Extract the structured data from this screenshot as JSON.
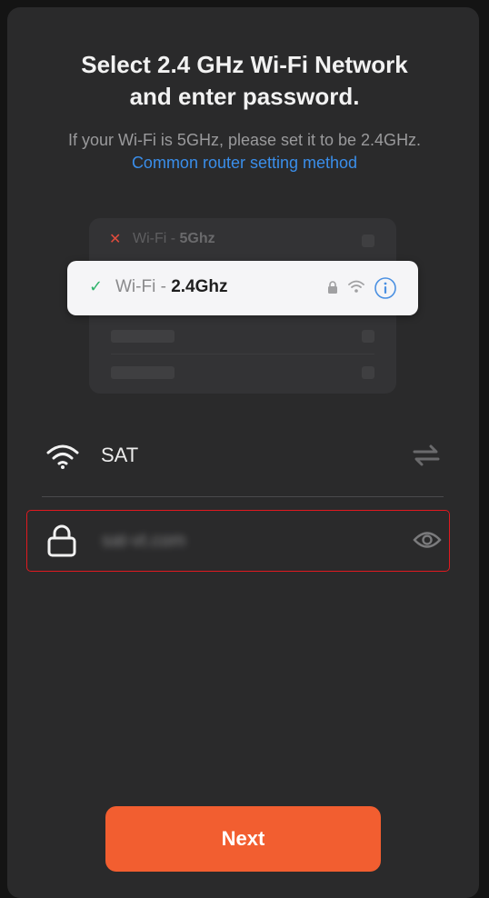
{
  "header": {
    "title": "Select 2.4 GHz Wi-Fi Network\nand enter password.",
    "subtitle_text": "If your Wi-Fi is 5GHz, please set it to be 2.4GHz. ",
    "subtitle_link": "Common router setting method"
  },
  "illustration": {
    "network_5g_prefix": "Wi-Fi - ",
    "network_5g_band": "5Ghz",
    "network_24g_prefix": "Wi-Fi - ",
    "network_24g_band": "2.4Ghz",
    "x_mark": "✕",
    "check_mark": "✓"
  },
  "form": {
    "ssid": "SAT",
    "password": "sat-vt.com"
  },
  "footer": {
    "next_label": "Next"
  },
  "colors": {
    "accent": "#f25e30",
    "link": "#3a8eea",
    "error_border": "#e0191f",
    "success": "#2fb36b"
  },
  "icons": [
    "wifi-icon",
    "switch-network-icon",
    "lock-icon",
    "eye-icon",
    "info-icon"
  ]
}
